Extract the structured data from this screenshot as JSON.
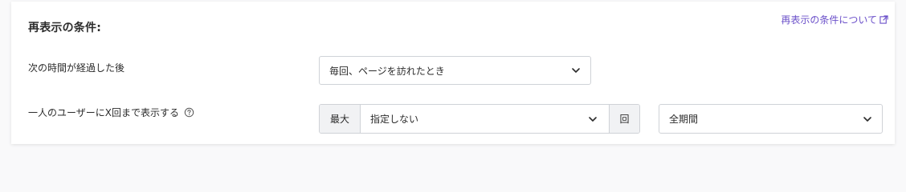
{
  "section": {
    "title": "再表示の条件:",
    "help_link": "再表示の条件について"
  },
  "rows": [
    {
      "label": "次の時間が経過した後",
      "select_value": "毎回、ページを訪れたとき"
    },
    {
      "label": "一人のユーザーにX回まで表示する",
      "prefix": "最大",
      "select_value": "指定しない",
      "suffix": "回",
      "period_value": "全期間"
    }
  ],
  "icons": {
    "help": "question-circle-icon",
    "external": "external-link-icon",
    "dropdown": "chevron-down-icon"
  },
  "colors": {
    "link": "#6a4fc9",
    "border": "#cfd2d7",
    "addon_bg": "#f1f2f4"
  }
}
